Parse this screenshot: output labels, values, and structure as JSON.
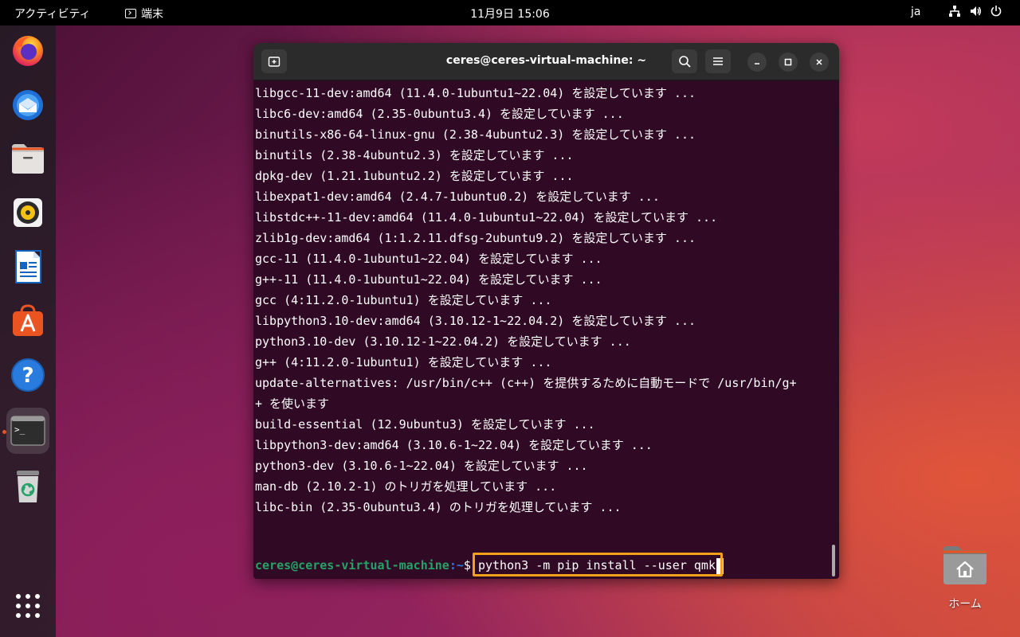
{
  "topbar": {
    "activities": "アクティビティ",
    "app_name": "端末",
    "clock": "11月9日  15:06",
    "language": "ja",
    "tray_icons": [
      "network-icon",
      "volume-icon",
      "power-icon"
    ]
  },
  "dock": {
    "items": [
      {
        "name": "firefox",
        "icon": "firefox-icon"
      },
      {
        "name": "thunderbird",
        "icon": "thunderbird-icon"
      },
      {
        "name": "files",
        "icon": "files-icon"
      },
      {
        "name": "rhythmbox",
        "icon": "rhythmbox-icon"
      },
      {
        "name": "libreoffice-writer",
        "icon": "writer-icon"
      },
      {
        "name": "app-center",
        "icon": "app-center-icon"
      },
      {
        "name": "help",
        "icon": "help-icon"
      },
      {
        "name": "terminal",
        "icon": "terminal-icon",
        "active": true
      },
      {
        "name": "trash",
        "icon": "trash-icon"
      }
    ],
    "show_apps_icon": "app-grid-icon"
  },
  "window": {
    "title": "ceres@ceres-virtual-machine: ~",
    "lines": [
      "libgcc-11-dev:amd64 (11.4.0-1ubuntu1~22.04) を設定しています ...",
      "libc6-dev:amd64 (2.35-0ubuntu3.4) を設定しています ...",
      "binutils-x86-64-linux-gnu (2.38-4ubuntu2.3) を設定しています ...",
      "binutils (2.38-4ubuntu2.3) を設定しています ...",
      "dpkg-dev (1.21.1ubuntu2.2) を設定しています ...",
      "libexpat1-dev:amd64 (2.4.7-1ubuntu0.2) を設定しています ...",
      "libstdc++-11-dev:amd64 (11.4.0-1ubuntu1~22.04) を設定しています ...",
      "zlib1g-dev:amd64 (1:1.2.11.dfsg-2ubuntu9.2) を設定しています ...",
      "gcc-11 (11.4.0-1ubuntu1~22.04) を設定しています ...",
      "g++-11 (11.4.0-1ubuntu1~22.04) を設定しています ...",
      "gcc (4:11.2.0-1ubuntu1) を設定しています ...",
      "libpython3.10-dev:amd64 (3.10.12-1~22.04.2) を設定しています ...",
      "python3.10-dev (3.10.12-1~22.04.2) を設定しています ...",
      "g++ (4:11.2.0-1ubuntu1) を設定しています ...",
      "update-alternatives: /usr/bin/c++ (c++) を提供するために自動モードで /usr/bin/g+",
      "+ を使います",
      "build-essential (12.9ubuntu3) を設定しています ...",
      "libpython3-dev:amd64 (3.10.6-1~22.04) を設定しています ...",
      "python3-dev (3.10.6-1~22.04) を設定しています ...",
      "man-db (2.10.2-1) のトリガを処理しています ...",
      "libc-bin (2.35-0ubuntu3.4) のトリガを処理しています ..."
    ],
    "prompt_user": "ceres@ceres-virtual-machine",
    "prompt_path": ":~",
    "prompt_symbol": "$ ",
    "command": "python3 -m pip install --user qmk"
  },
  "desktop": {
    "home_label": "ホーム"
  },
  "colors": {
    "accent": "#e95420",
    "terminal_bg": "#300a24",
    "highlight": "#f4a019",
    "prompt_green": "#26a269",
    "prompt_blue": "#2a7bde"
  }
}
